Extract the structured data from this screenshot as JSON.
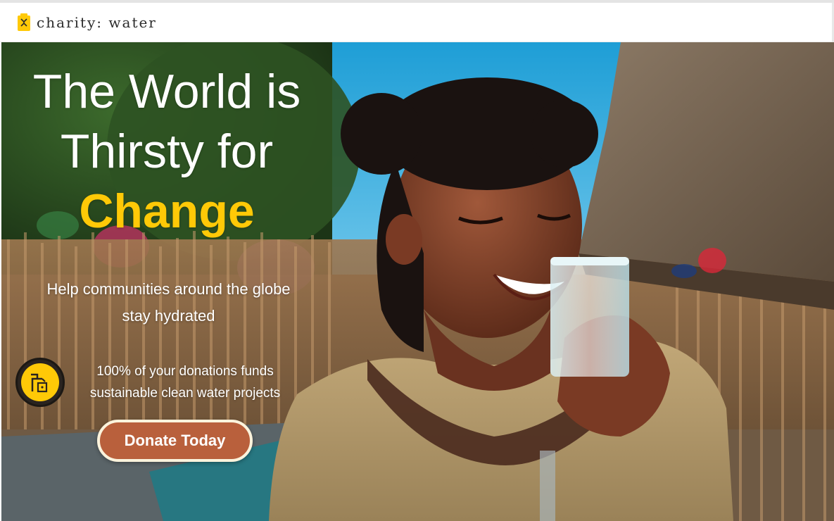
{
  "brand": {
    "name": "charity: water",
    "logo_icon": "jerry-can-icon",
    "accent_color": "#ffc907"
  },
  "hero": {
    "headline_line1": "The World is",
    "headline_line2": "Thirsty for",
    "headline_accent": "Change",
    "subhead_line1": "Help communities around the globe",
    "subhead_line2": "stay hydrated",
    "badge_icon": "water-pump-icon",
    "badge_line1": "100% of your donations funds",
    "badge_line2": "sustainable clean water projects",
    "donate_label": "Donate Today",
    "donate_color": "#b9603c",
    "image_subject": "girl-drinking-water-photo"
  }
}
